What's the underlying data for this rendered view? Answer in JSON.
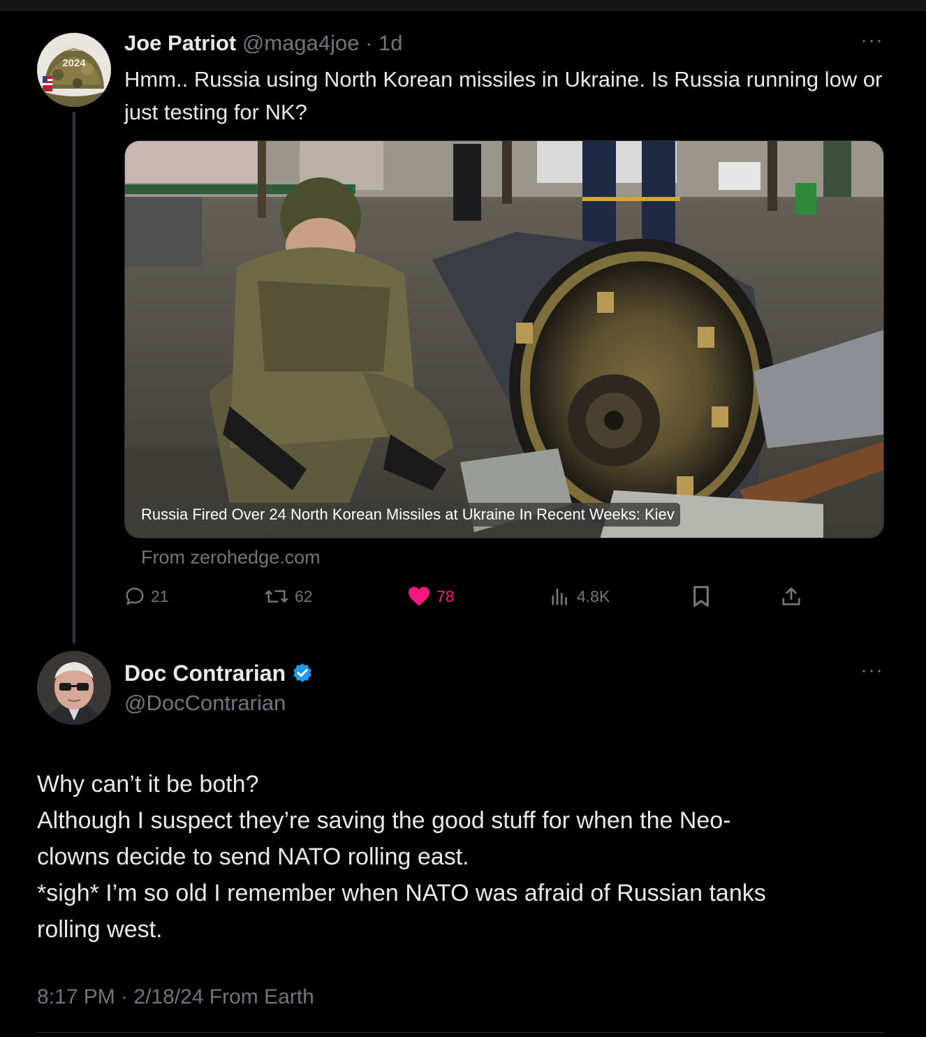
{
  "parent_tweet": {
    "author_name": "Joe Patriot",
    "author_handle": "@maga4joe",
    "separator": "·",
    "time": "1d",
    "more_label": "···",
    "avatar_hat_text_top": "TRUMP",
    "avatar_hat_text_bottom": "2024",
    "text": "Hmm.. Russia using North Korean missiles in Ukraine. Is Russia running low or just testing for NK?",
    "media_caption": "Russia Fired Over 24 North Korean Missiles at Ukraine In Recent Weeks: Kiev",
    "source_text": "From zerohedge.com",
    "actions": {
      "replies": "21",
      "reposts": "62",
      "likes": "78",
      "views": "4.8K"
    },
    "like_color": "#f91880"
  },
  "reply_tweet": {
    "author_name": "Doc Contrarian",
    "author_handle": "@DocContrarian",
    "verified": true,
    "more_label": "···",
    "lines": [
      "Why can’t it be both?",
      "Although I suspect they’re saving the good stuff for when the Neo-",
      "clowns decide to send NATO rolling east.",
      "*sigh* I’m so old I remember when NATO was afraid of Russian tanks",
      "rolling west."
    ],
    "meta": "8:17 PM · 2/18/24 From Earth"
  },
  "colors": {
    "background": "#000000",
    "text": "#e7e9ea",
    "secondary_text": "#71767b",
    "verified_blue": "#1d9bf0"
  }
}
